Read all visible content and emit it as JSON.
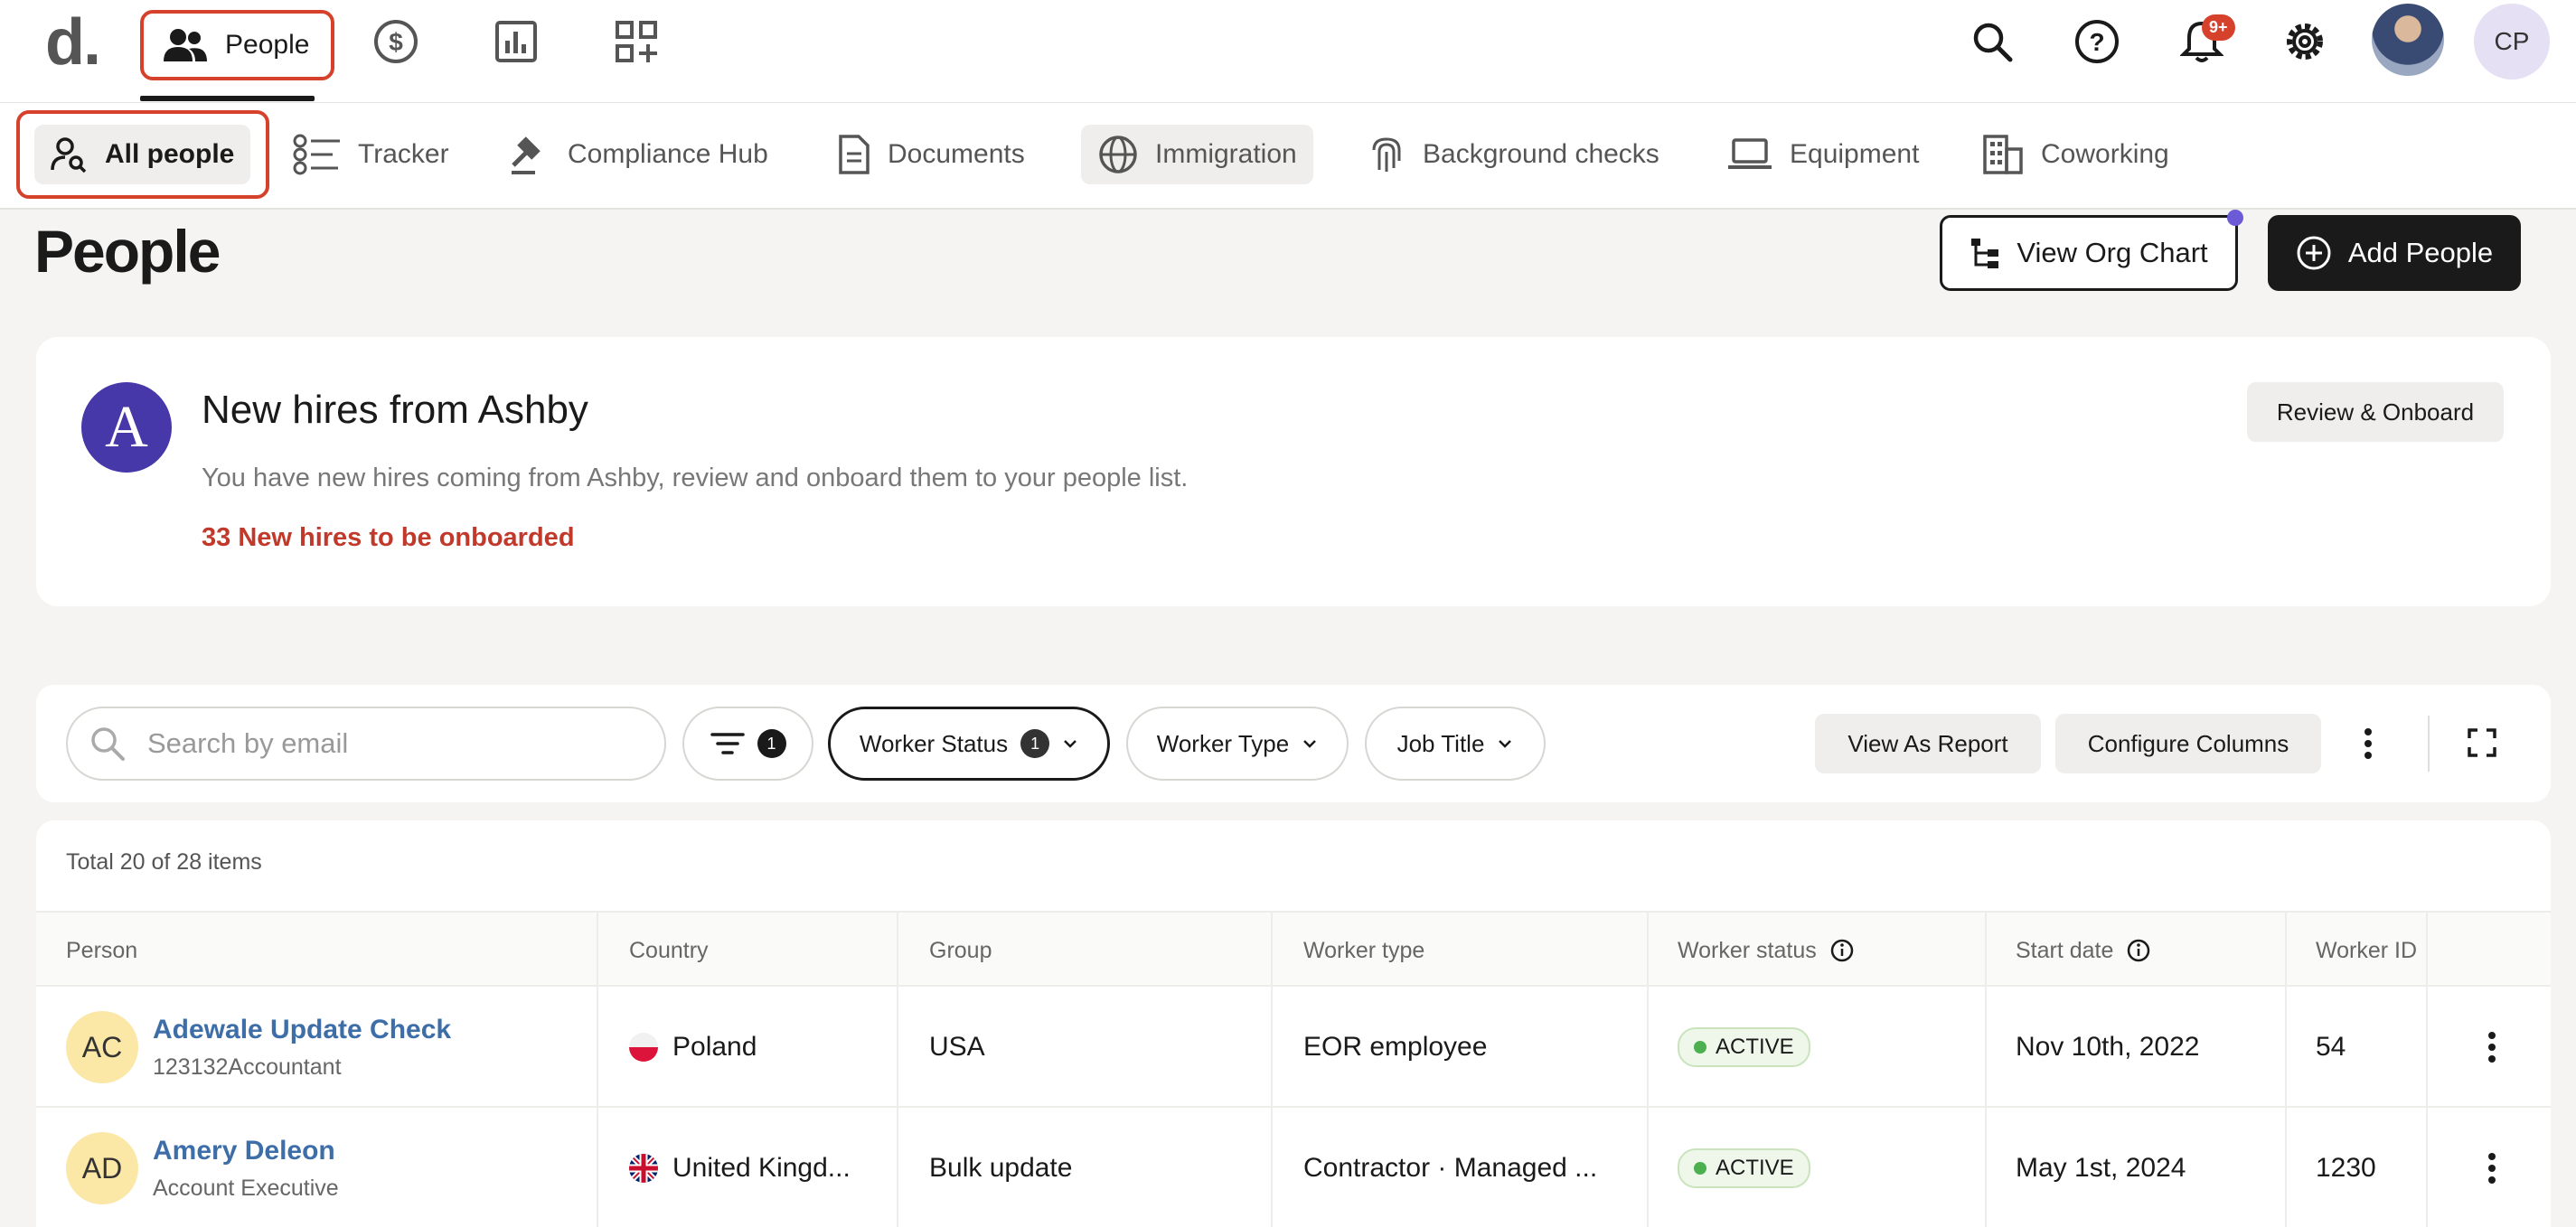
{
  "topnav": {
    "logo": "d.",
    "people_label": "People",
    "icons": [
      "dollar-icon",
      "chart-icon",
      "apps-add-icon"
    ],
    "notifications_badge": "9+",
    "user_initials": "CP"
  },
  "subnav": {
    "items": [
      {
        "label": "All people",
        "icon": "user-search-icon"
      },
      {
        "label": "Tracker",
        "icon": "checklist-icon"
      },
      {
        "label": "Compliance Hub",
        "icon": "gavel-icon"
      },
      {
        "label": "Documents",
        "icon": "document-icon"
      },
      {
        "label": "Immigration",
        "icon": "globe-icon"
      },
      {
        "label": "Background checks",
        "icon": "fingerprint-icon"
      },
      {
        "label": "Equipment",
        "icon": "laptop-icon"
      },
      {
        "label": "Coworking",
        "icon": "building-icon"
      }
    ]
  },
  "header": {
    "title": "People",
    "org_chart_label": "View Org Chart",
    "add_people_label": "Add People"
  },
  "ashby": {
    "logo_letter": "A",
    "title": "New hires from Ashby",
    "description": "You have new hires coming from Ashby, review and onboard them to your people list.",
    "count_text": "33 New hires to be onboarded",
    "review_label": "Review & Onboard"
  },
  "filters": {
    "search_placeholder": "Search by email",
    "filter_count": "1",
    "worker_status_label": "Worker Status",
    "worker_status_count": "1",
    "worker_type_label": "Worker Type",
    "job_title_label": "Job Title",
    "view_report_label": "View As Report",
    "configure_label": "Configure Columns"
  },
  "table": {
    "total_text": "Total 20 of 28 items",
    "columns": [
      "Person",
      "Country",
      "Group",
      "Worker type",
      "Worker status",
      "Start date",
      "Worker ID"
    ],
    "rows": [
      {
        "initials": "AC",
        "name": "Adewale Update Check",
        "subtitle": "123132Accountant",
        "country": "Poland",
        "group": "USA",
        "worker_type": "EOR employee",
        "status": "ACTIVE",
        "start_date": "Nov 10th, 2022",
        "worker_id": "54"
      },
      {
        "initials": "AD",
        "name": "Amery Deleon",
        "subtitle": "Account Executive",
        "country": "United Kingd...",
        "group": "Bulk update",
        "worker_type": "Contractor · Managed ...",
        "status": "ACTIVE",
        "start_date": "May 1st, 2024",
        "worker_id": "1230"
      }
    ]
  },
  "colors": {
    "accent_red": "#d6412c",
    "ashby_purple": "#4638a8",
    "link_blue": "#3d6ea8",
    "active_green": "#4caf50"
  }
}
